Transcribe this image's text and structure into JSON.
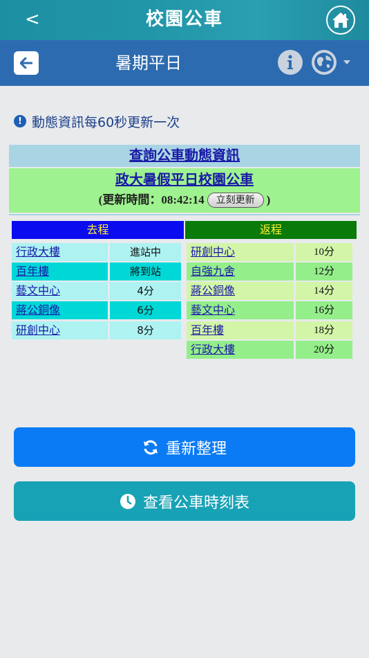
{
  "topbar": {
    "back_label": "<",
    "title": "校園公車",
    "home_icon": "home-icon"
  },
  "subbar": {
    "title": "暑期平日",
    "back_icon": "arrow-left-icon",
    "info_icon": "info-icon",
    "lang_icon": "globe-icon"
  },
  "notice": {
    "icon": "exclamation-circle-icon",
    "text": "動態資訊每60秒更新一次"
  },
  "query": {
    "heading": "查詢公車動態資訊",
    "route_name": "政大暑假平日校園公車",
    "update_prefix": "(更新時間：",
    "update_time": "08:42:14",
    "refresh_now_label": "立刻更新",
    "update_suffix": ")"
  },
  "outbound": {
    "header": "去程",
    "stops": [
      {
        "name": "行政大樓",
        "status": "進站中"
      },
      {
        "name": "百年樓",
        "status": "將到站"
      },
      {
        "name": "藝文中心",
        "status": "4分"
      },
      {
        "name": "蔣公銅像",
        "status": "6分"
      },
      {
        "name": "研創中心",
        "status": "8分"
      }
    ]
  },
  "return": {
    "header": "返程",
    "stops": [
      {
        "name": "研創中心",
        "status": "10分"
      },
      {
        "name": "自強九舍",
        "status": "12分"
      },
      {
        "name": "蔣公銅像",
        "status": "14分"
      },
      {
        "name": "藝文中心",
        "status": "16分"
      },
      {
        "name": "百年樓",
        "status": "18分"
      },
      {
        "name": "行政大樓",
        "status": "20分"
      }
    ]
  },
  "buttons": {
    "refresh_label": "重新整理",
    "refresh_icon": "sync-icon",
    "schedule_label": "查看公車時刻表",
    "schedule_icon": "clock-icon"
  },
  "colors": {
    "topbar": "#2196a8",
    "subbar": "#2d6bb0",
    "outbound_header": "#0b0bf0",
    "return_header": "#0a7a0a",
    "refresh_button": "#0a7bf5",
    "schedule_button": "#18a2b6"
  }
}
